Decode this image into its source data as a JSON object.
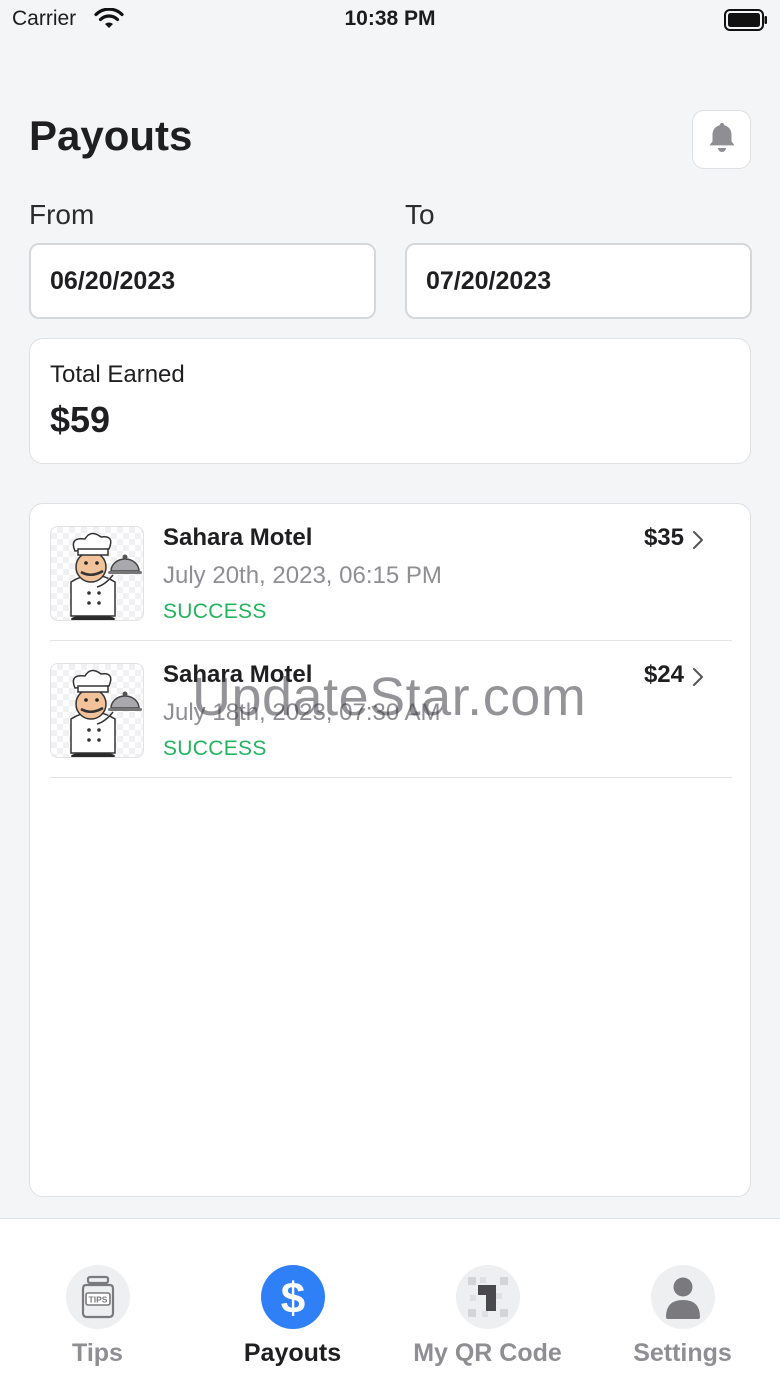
{
  "status_bar": {
    "carrier": "Carrier",
    "time": "10:38 PM",
    "wifi_icon": "wifi-icon",
    "battery_icon": "battery-icon"
  },
  "header": {
    "title": "Payouts",
    "notification_icon": "bell-icon"
  },
  "date_range": {
    "from_label": "From",
    "from_value": "06/20/2023",
    "to_label": "To",
    "to_value": "07/20/2023"
  },
  "summary": {
    "label": "Total Earned",
    "value": "$59"
  },
  "payouts": [
    {
      "name": "Sahara Motel",
      "date": "July 20th, 2023, 06:15 PM",
      "status": "SUCCESS",
      "amount": "$35",
      "thumbnail_icon": "chef-icon"
    },
    {
      "name": "Sahara Motel",
      "date": "July 18th, 2023, 07:30 AM",
      "status": "SUCCESS",
      "amount": "$24",
      "thumbnail_icon": "chef-icon"
    }
  ],
  "watermark": "UpdateStar.com",
  "tab_bar": {
    "tabs": [
      {
        "label": "Tips",
        "icon": "tips-jar-icon",
        "active": false
      },
      {
        "label": "Payouts",
        "icon": "dollar-icon",
        "active": true
      },
      {
        "label": "My QR Code",
        "icon": "qr-code-icon",
        "active": false
      },
      {
        "label": "Settings",
        "icon": "person-icon",
        "active": false
      }
    ]
  },
  "colors": {
    "accent": "#2f7ff7",
    "success": "#22b45e",
    "muted_text": "#8e8e93",
    "background": "#f4f5f7"
  }
}
